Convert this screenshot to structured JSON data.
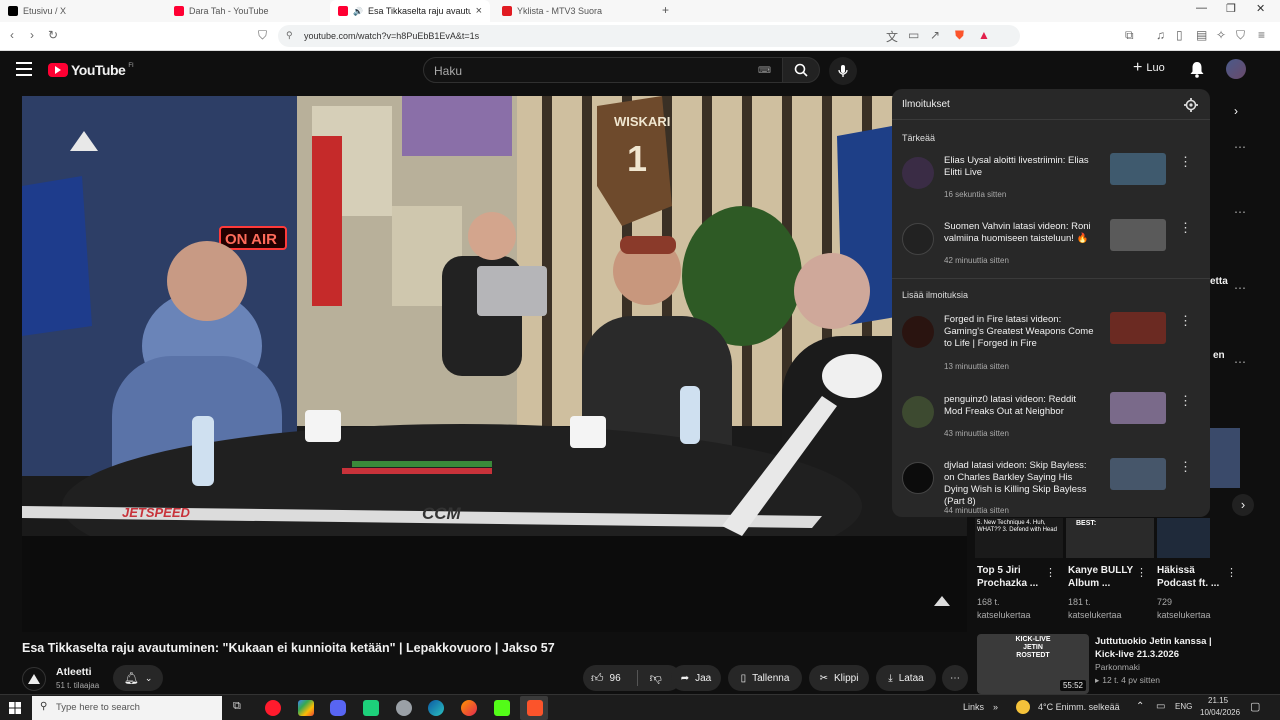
{
  "browser": {
    "tabs": [
      {
        "label": "Etusivu / X",
        "color": "#000000"
      },
      {
        "label": "Dara Tah - YouTube",
        "color": "#ff0033"
      },
      {
        "label": "Esa Tikkaselta raju avautuminen",
        "color": "#ff0033"
      },
      {
        "label": "Yklista - MTV3 Suora",
        "color": "#e11b22"
      }
    ],
    "new_tab": "+",
    "url": "youtube.com/watch?v=h8PuEbB1EvA&t=1s"
  },
  "youtube": {
    "logo": "YouTube",
    "region": "FI",
    "search_placeholder": "Haku",
    "create_label": "Luo"
  },
  "notifications": {
    "title": "Ilmoitukset",
    "section_important": "Tärkeää",
    "section_more": "Lisää ilmoituksia",
    "items": [
      {
        "text": "Elias Uysal aloitti livestriimin: Elias Elitti Live",
        "time": "16 sekuntia sitten",
        "avatar_color": "#3a2c45",
        "thumb_color": "#3f5a6e"
      },
      {
        "text": "Suomen Vahvin latasi videon: Roni valmiina huomiseen taisteluun! 🔥",
        "time": "42 minuuttia sitten",
        "avatar_color": "#222222",
        "thumb_color": "#5a5a5a"
      },
      {
        "text": "Forged in Fire latasi videon: Gaming's Greatest Weapons Come to Life | Forged in Fire",
        "time": "13 minuuttia sitten",
        "avatar_color": "#2a1410",
        "thumb_color": "#6b2a22"
      },
      {
        "text": "penguinz0 latasi videon: Reddit Mod Freaks Out at Neighbor",
        "time": "43 minuuttia sitten",
        "avatar_color": "#3d4a30",
        "thumb_color": "#7a6a8a"
      },
      {
        "text": "djvlad latasi videon: Skip Bayless: on Charles Barkley Saying His Dying Wish is Killing Skip Bayless (Part 8)",
        "time": "44 minuuttia sitten",
        "avatar_color": "#0c0c0c",
        "thumb_color": "#46566a"
      }
    ]
  },
  "video": {
    "title": "Esa Tikkaselta raju avautuminen: \"Kukaan ei kunnioita ketään\" | Lepakkovuoro | Jakso 57",
    "channel": "Atleetti",
    "subscribers": "51 t. tilaajaa",
    "likes": "96",
    "share": "Jaa",
    "save": "Tallenna",
    "clip": "Klippi",
    "download": "Lataa",
    "on_air_sign": "ON AIR",
    "stick_brand": "JETSPEED",
    "stick_ccm": "CCM",
    "jersey_name": "WISKARI",
    "jersey_number": "1"
  },
  "recommendations": [
    {
      "title": "Top 5 Jiri Prochazka ...",
      "meta": "168 t. katselukertaa",
      "thumb_text": "5. New Technique 4. Huh, WHAT?? 3. Defend with Head"
    },
    {
      "title": "Kanye BULLY Album ...",
      "meta": "181 t. katselukertaa",
      "thumb_text": "BEST:"
    },
    {
      "title": "Häkissä Podcast ft. ...",
      "meta": "729 katselukertaa",
      "thumb_text": ""
    },
    {
      "title": "Juttutuokio Jetin kanssa | Kick-live 21.3.2026",
      "channel": "Parkonmaki",
      "meta": "12 t. 4 pv sitten",
      "duration": "55:52",
      "thumb_text": "KICK-LIVE JETIN ROSTEDT"
    }
  ],
  "sidebar_cut": [
    "etta",
    "en"
  ],
  "taskbar": {
    "search_placeholder": "Type here to search",
    "links": "Links",
    "weather": "4°C Enimm. selkeää",
    "lang": "ENG",
    "time": "21.15",
    "date": "10/04/2026"
  },
  "colors": {
    "yt_red": "#ff0033",
    "bg": "#0f0f0f",
    "panel": "#282828"
  }
}
